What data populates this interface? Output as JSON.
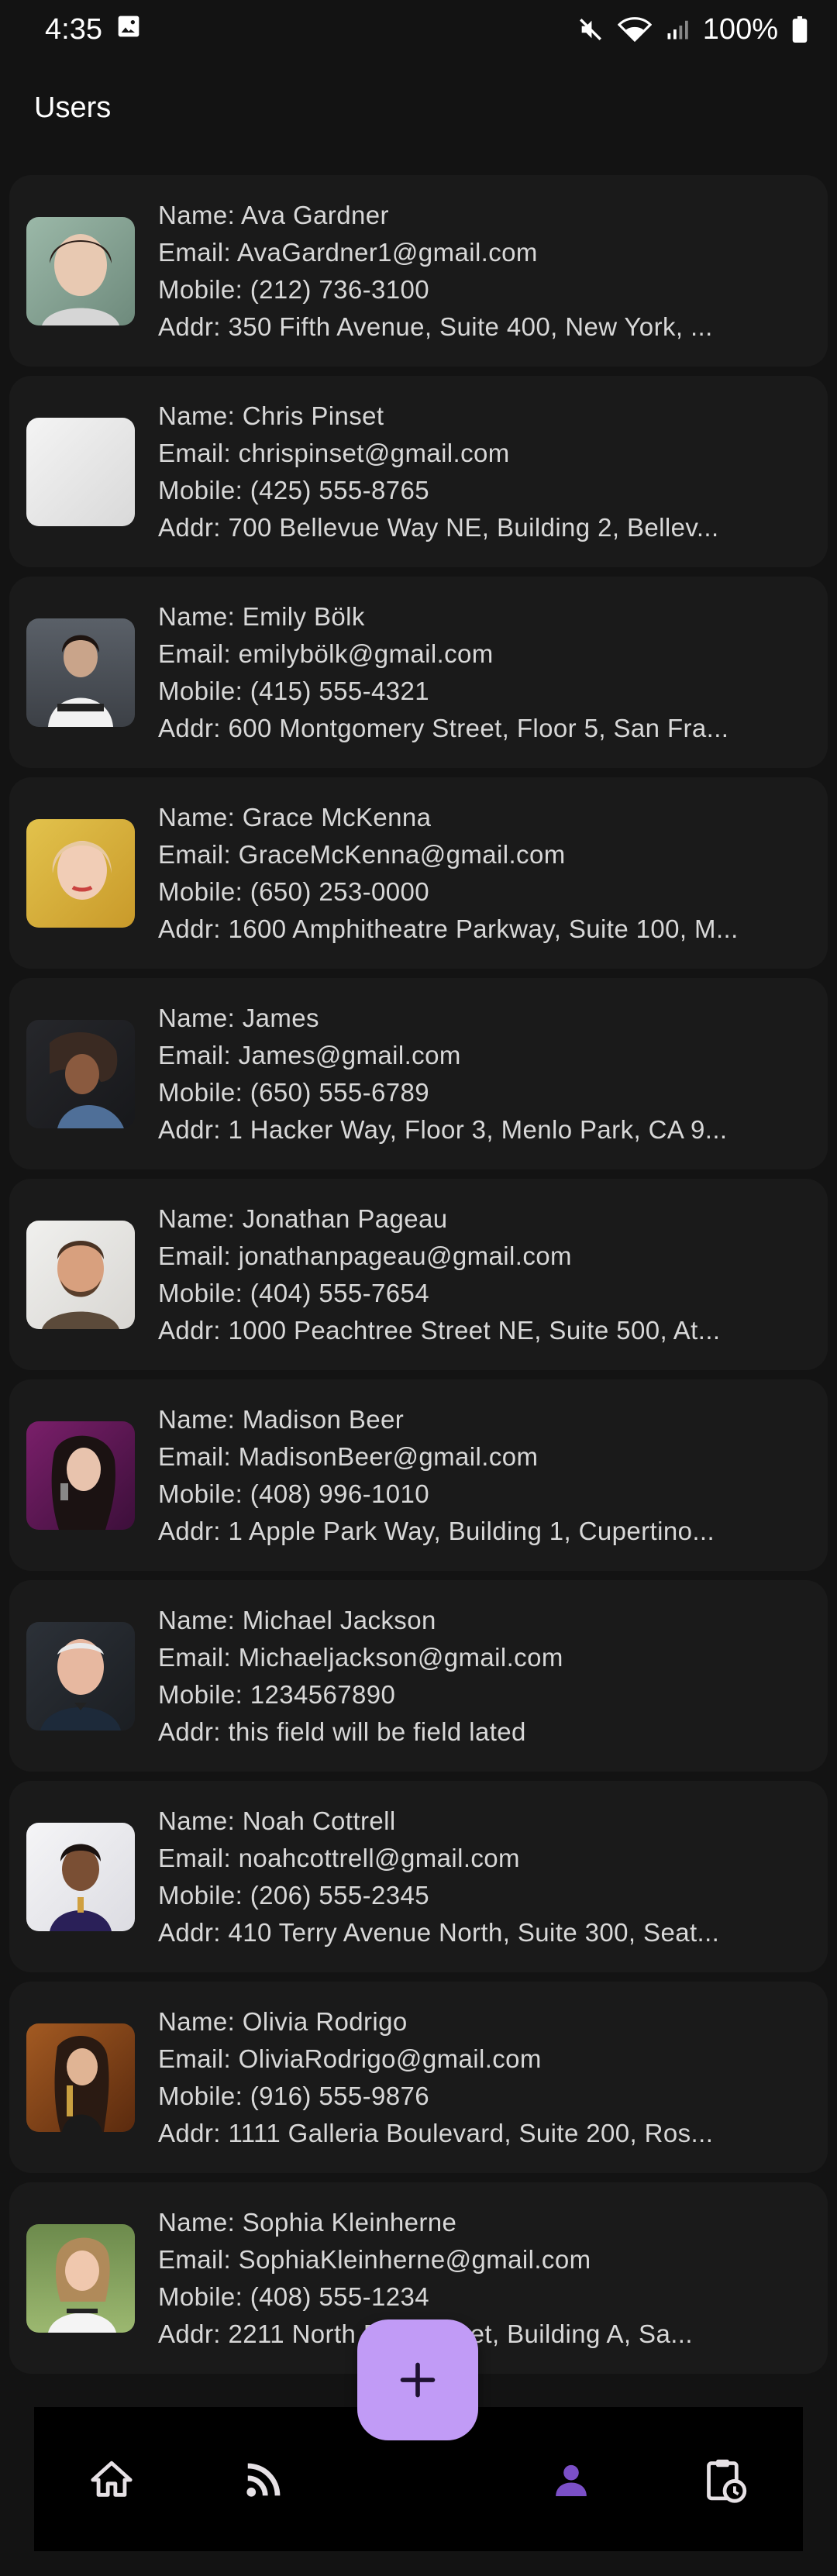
{
  "status_bar": {
    "time": "4:35",
    "battery": "100%",
    "icons": [
      "image-icon",
      "mute-icon",
      "wifi-icon",
      "signal-icon",
      "battery-icon"
    ]
  },
  "app": {
    "title": "Users"
  },
  "users": [
    {
      "name": "Name: Ava Gardner",
      "email": "Email: AvaGardner1@gmail.com",
      "mobile": "Mobile: (212) 736-3100",
      "addr": "Addr: 350 Fifth Avenue, Suite 400, New York, ..."
    },
    {
      "name": "Name: Chris Pinset",
      "email": "Email: chrispinset@gmail.com",
      "mobile": "Mobile: (425) 555-8765",
      "addr": "Addr: 700 Bellevue Way NE, Building 2, Bellev..."
    },
    {
      "name": "Name: Emily Bölk",
      "email": "Email: emilybölk@gmail.com",
      "mobile": "Mobile: (415) 555-4321",
      "addr": "Addr: 600 Montgomery Street, Floor 5, San Fra..."
    },
    {
      "name": "Name: Grace McKenna",
      "email": "Email: GraceMcKenna@gmail.com",
      "mobile": "Mobile: (650) 253-0000",
      "addr": "Addr: 1600 Amphitheatre Parkway, Suite 100, M..."
    },
    {
      "name": "Name: James",
      "email": "Email: James@gmail.com",
      "mobile": "Mobile: (650) 555-6789",
      "addr": "Addr: 1 Hacker Way, Floor 3, Menlo Park, CA 9..."
    },
    {
      "name": "Name: Jonathan Pageau",
      "email": "Email: jonathanpageau@gmail.com",
      "mobile": "Mobile: (404) 555-7654",
      "addr": "Addr: 1000 Peachtree Street NE, Suite 500, At..."
    },
    {
      "name": "Name: Madison Beer",
      "email": "Email: MadisonBeer@gmail.com",
      "mobile": "Mobile: (408) 996-1010",
      "addr": "Addr: 1 Apple Park Way, Building 1, Cupertino..."
    },
    {
      "name": "Name: Michael Jackson",
      "email": "Email: Michaeljackson@gmail.com",
      "mobile": "Mobile: 1234567890",
      "addr": "Addr: this field will be field lated"
    },
    {
      "name": "Name: Noah Cottrell",
      "email": "Email: noahcottrell@gmail.com",
      "mobile": "Mobile: (206) 555-2345",
      "addr": "Addr: 410 Terry Avenue North, Suite 300, Seat..."
    },
    {
      "name": "Name: Olivia Rodrigo",
      "email": "Email: OliviaRodrigo@gmail.com",
      "mobile": "Mobile: (916) 555-9876",
      "addr": "Addr: 1111 Galleria Boulevard, Suite 200, Ros..."
    },
    {
      "name": "Name: Sophia Kleinherne",
      "email": "Email: SophiaKleinherne@gmail.com",
      "mobile": "Mobile: (408) 555-1234",
      "addr": "Addr: 2211 North First Street, Building A, Sa..."
    }
  ],
  "fab": {
    "icon": "plus-icon"
  },
  "bottom_nav": {
    "items": [
      {
        "icon": "home-icon",
        "active": false
      },
      {
        "icon": "rss-feed-icon",
        "active": false
      },
      {
        "icon": "person-icon",
        "active": true
      },
      {
        "icon": "clipboard-clock-icon",
        "active": false
      }
    ]
  },
  "colors": {
    "background": "#131313",
    "card": "#1a1a1a",
    "accent": "#c19bf6",
    "active_nav": "#7b4fc7"
  }
}
